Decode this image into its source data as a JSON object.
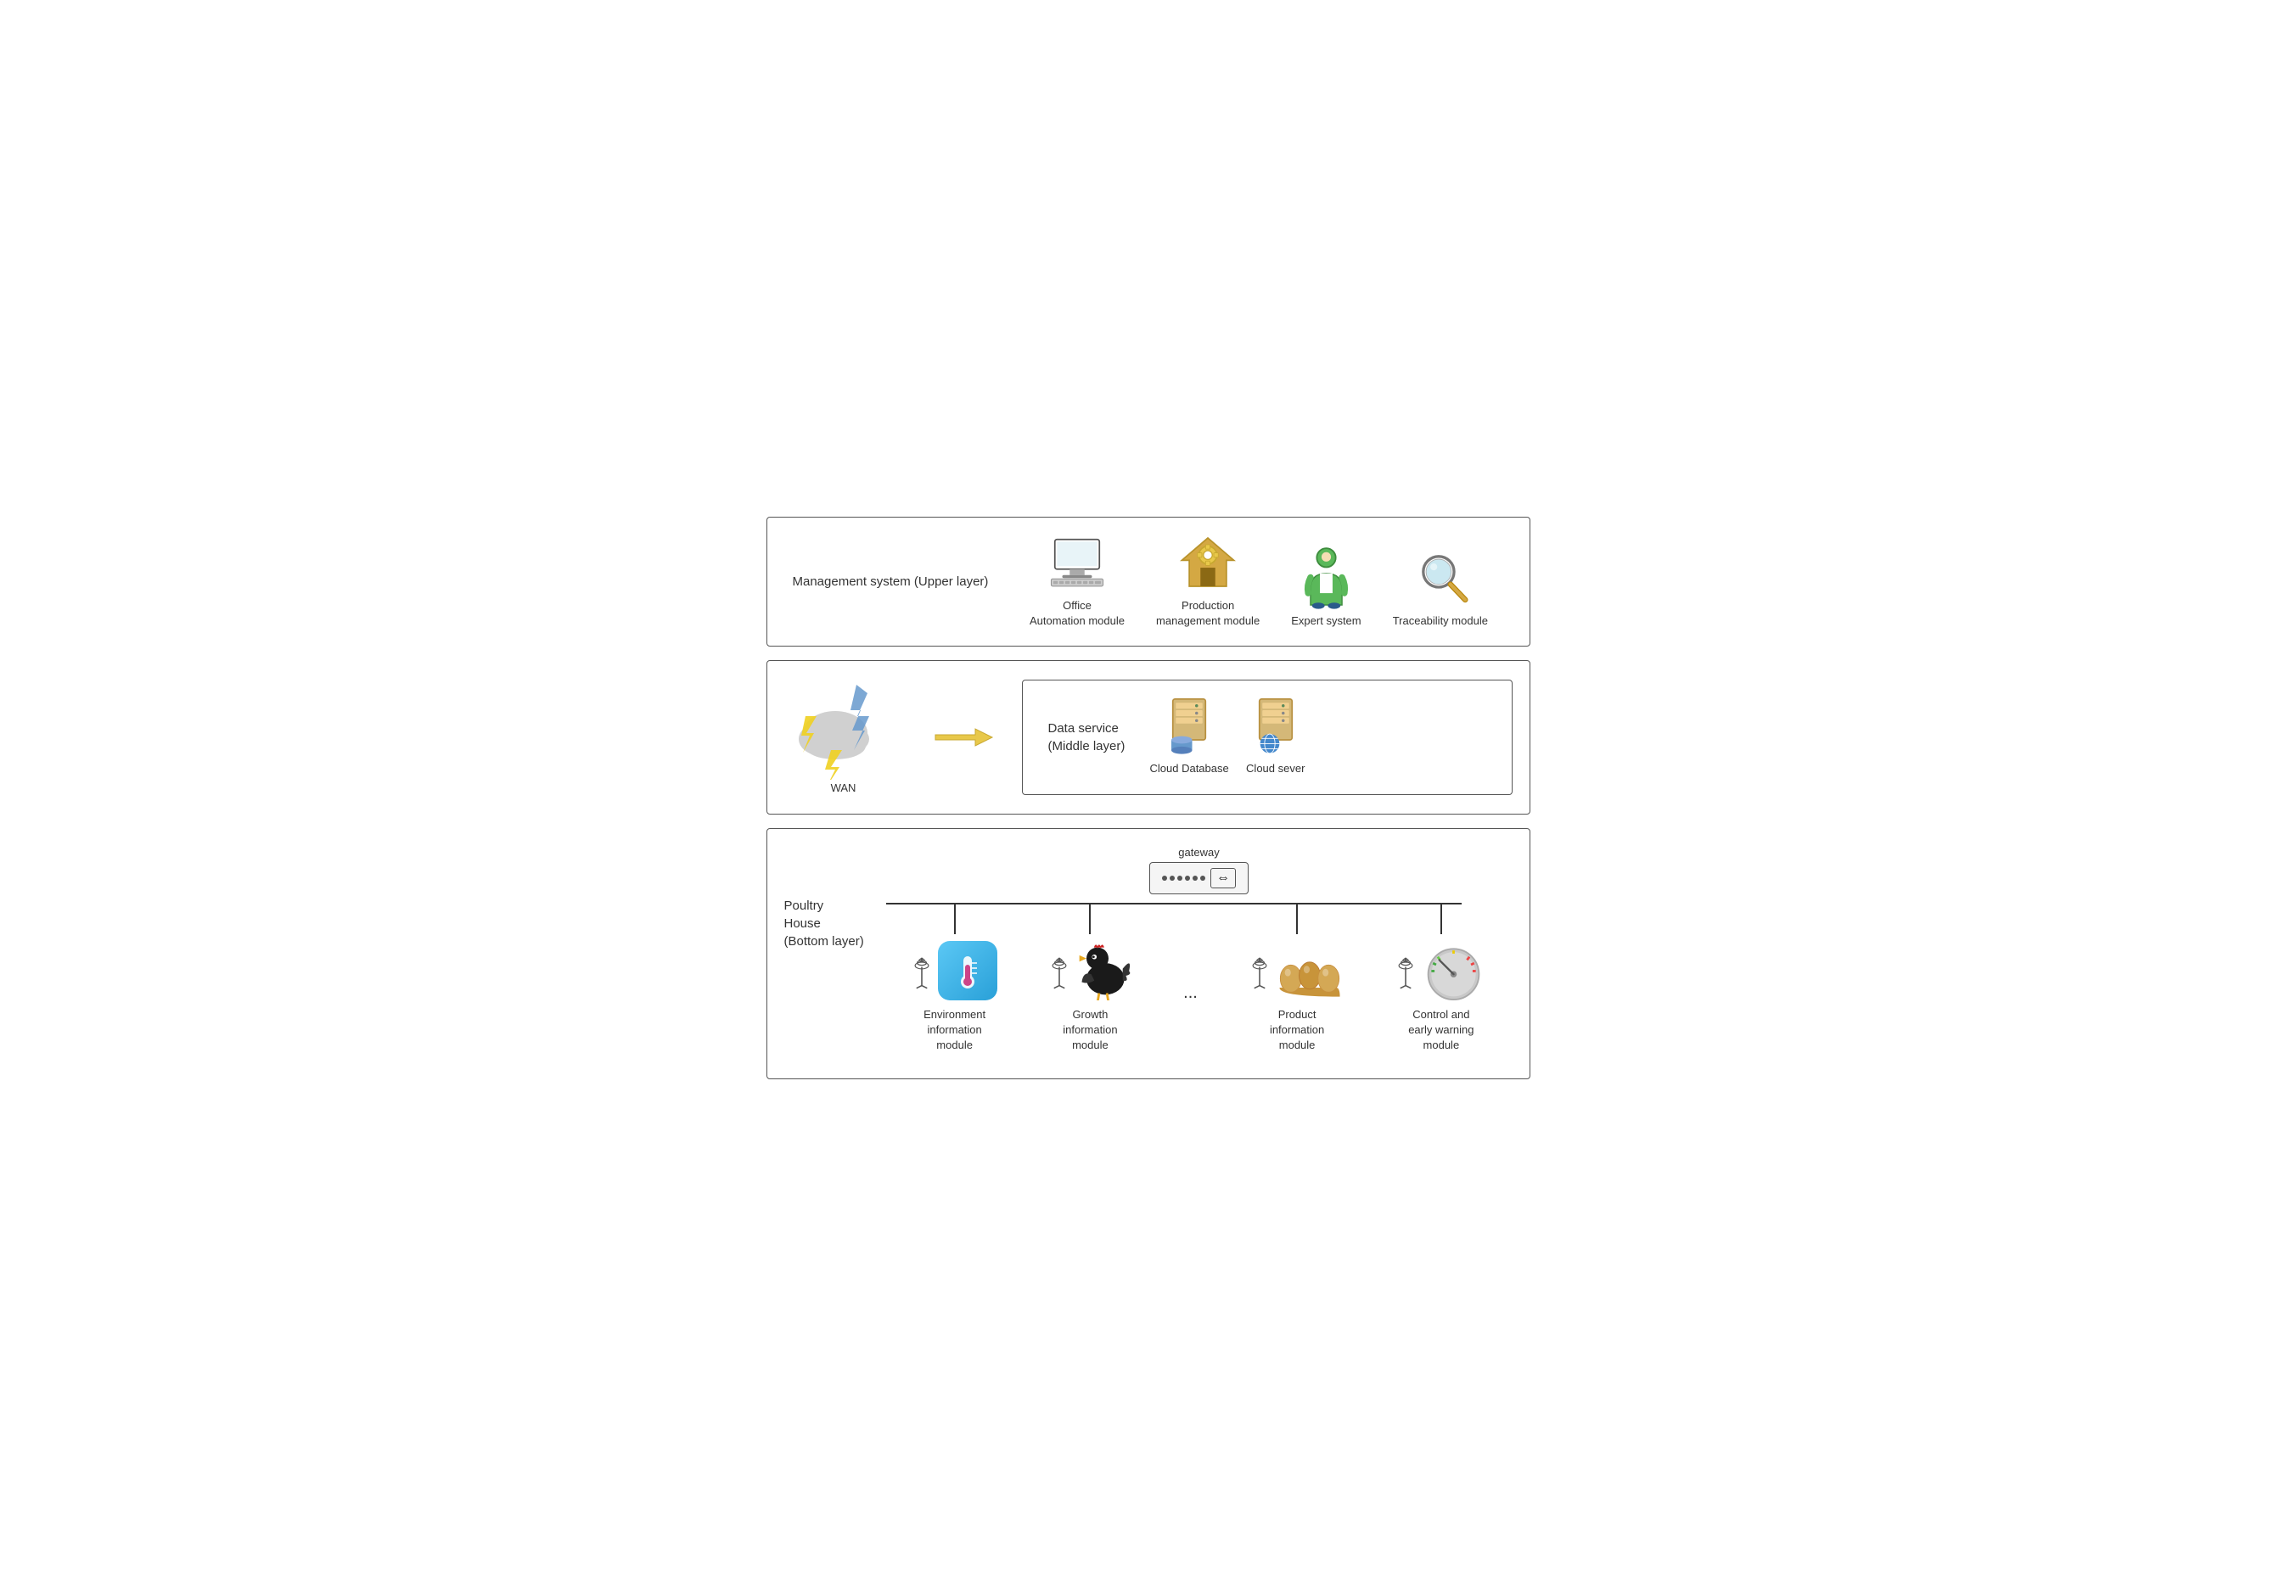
{
  "layers": {
    "top": {
      "label": "Management system (Upper layer)",
      "modules": [
        {
          "id": "office",
          "label": "Office\nAutomation module"
        },
        {
          "id": "production",
          "label": "Production\nmanagement module"
        },
        {
          "id": "expert",
          "label": "Expert system"
        },
        {
          "id": "traceability",
          "label": "Traceability module"
        }
      ]
    },
    "middle": {
      "wan_label": "WAN",
      "data_service_label": "Data service\n(Middle layer)",
      "modules": [
        {
          "id": "cloud-db",
          "label": "Cloud Database"
        },
        {
          "id": "cloud-server",
          "label": "Cloud sever"
        }
      ]
    },
    "bottom": {
      "label": "Poultry\nHouse\n(Bottom layer)",
      "gateway_label": "gateway",
      "modules": [
        {
          "id": "environment",
          "label": "Environment\ninformation\nmodule"
        },
        {
          "id": "growth",
          "label": "Growth\ninformation\nmodule"
        },
        {
          "id": "product",
          "label": "Product\ninformation\nmodule"
        },
        {
          "id": "control",
          "label": "Control and\nearly warning\nmodule"
        }
      ]
    }
  }
}
